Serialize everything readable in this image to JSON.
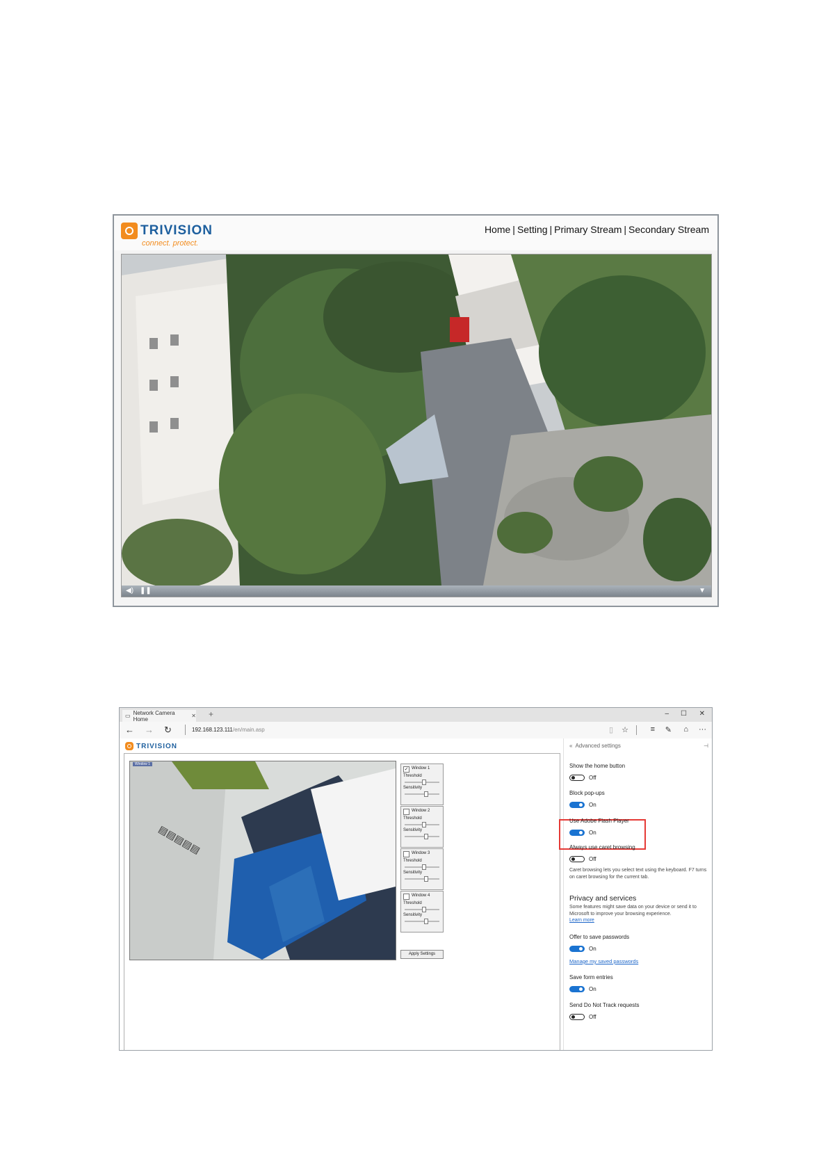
{
  "shot1": {
    "brand": "TRIVISION",
    "tagline": "connect. protect.",
    "nav": [
      "Home",
      "Setting",
      "Primary Stream",
      "Secondary Stream"
    ]
  },
  "shot2": {
    "tab_title": "Network Camera Home",
    "url_host": "192.168.123.111",
    "url_path": "/en/main.asp",
    "brand": "TRIVISION",
    "video_label": "Window 1",
    "windows": [
      {
        "label": "Window 1",
        "checked": true,
        "threshold": "Threshold",
        "sensitivity": "Sensitivity"
      },
      {
        "label": "Window 2",
        "checked": false,
        "threshold": "Threshold",
        "sensitivity": "Sensitivity"
      },
      {
        "label": "Window 3",
        "checked": false,
        "threshold": "Threshold",
        "sensitivity": "Sensitivity"
      },
      {
        "label": "Window 4",
        "checked": false,
        "threshold": "Threshold",
        "sensitivity": "Sensitivity"
      }
    ],
    "apply_label": "Apply Settings",
    "panel": {
      "header": "Advanced settings",
      "home_button_label": "Show the home button",
      "home_button_state": "Off",
      "popups_label": "Block pop-ups",
      "popups_state": "On",
      "flash_label": "Use Adobe Flash Player",
      "flash_state": "On",
      "caret_label": "Always use caret browsing",
      "caret_state": "Off",
      "caret_note": "Caret browsing lets you select text using the keyboard. F7 turns on caret browsing for the current tab.",
      "privacy_heading": "Privacy and services",
      "privacy_note": "Some features might save data on your device or send it to Microsoft to improve your browsing experience.",
      "learn_more": "Learn more",
      "passwords_label": "Offer to save passwords",
      "passwords_state": "On",
      "manage_passwords": "Manage my saved passwords",
      "form_label": "Save form entries",
      "form_state": "On",
      "dnt_label": "Send Do Not Track requests",
      "dnt_state": "Off"
    }
  },
  "colors": {
    "brand_blue": "#1d5f9e",
    "brand_orange": "#f28c1e",
    "toggle_on": "#1a73d1",
    "highlight": "#e53935"
  }
}
